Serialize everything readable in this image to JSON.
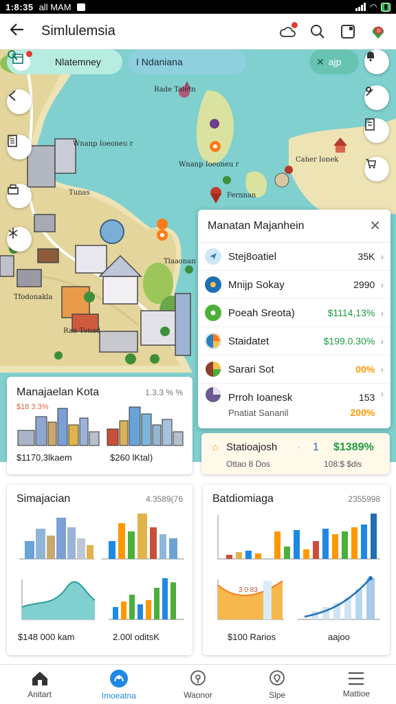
{
  "status_bar": {
    "time": "1:8:35",
    "carrier": "all MAM"
  },
  "app_bar": {
    "title": "Simlulemsia"
  },
  "map": {
    "chips": {
      "filter_label": "Nlatemney",
      "search_label": "I Ndaniana",
      "action_label": "ajp"
    },
    "labels": {
      "label_1": "Rade Taletn",
      "label_2": "Wnanp Ioeoneu r",
      "label_3": "Caher Ionek",
      "label_4": "Tunas",
      "label_5": "Fernnan",
      "label_6": "Tlaaonan",
      "label_7": "Tfodonakla",
      "label_8": "Ran Tonad"
    }
  },
  "popup": {
    "title": "Manatan Majanhein",
    "rows": [
      {
        "label": "Stej8oatiel",
        "value": "35K"
      },
      {
        "label": "Mnijp Sokay",
        "value": "2990"
      },
      {
        "label": "Poeah Sreota)",
        "value": "$1114,13%"
      },
      {
        "label": "Staidatet",
        "value": "$199.0.30%"
      },
      {
        "label": "Sarari Sot",
        "value": "00%"
      },
      {
        "label": "Prroh Ioanesk",
        "value": "153",
        "sub_label": "Pnatiat Sananil",
        "sub_value": "200%"
      }
    ]
  },
  "card_city": {
    "title": "Manajaelan Kota",
    "num": "1.3.3 % %",
    "sub": "$18 3.3%",
    "foot_left": "$1170,3lkaem",
    "foot_right": "$260 lKtal)"
  },
  "card_stat": {
    "title": "Statioajosh",
    "num": "1",
    "percent": "$1389%",
    "sub_left": "Ottao 8 Dos",
    "sub_right": "108:$ $dis"
  },
  "card_sim": {
    "title": "Simajacian",
    "num": "4.3589(76",
    "foot_left": "$148 000 kam",
    "foot_right": "2.00l oditsK"
  },
  "card_bat": {
    "title": "Batdiomiaga",
    "num": "2355998",
    "area_label": "3 0 83",
    "foot_left": "$100 Rarios",
    "foot_right": "aajoo"
  },
  "colors": {
    "accent": "#1e88e5",
    "sea": "#7fd0cf",
    "land": "#eee3b5",
    "green": "#1c9a40",
    "orange": "#ff9800"
  },
  "nav": [
    {
      "label": "Anitart",
      "icon": "home-icon"
    },
    {
      "label": "Imoeatna",
      "icon": "map-icon"
    },
    {
      "label": "Waonor",
      "icon": "pin-icon"
    },
    {
      "label": "Slpe",
      "icon": "location-icon"
    },
    {
      "label": "Mattioe",
      "icon": "menu-icon"
    }
  ]
}
